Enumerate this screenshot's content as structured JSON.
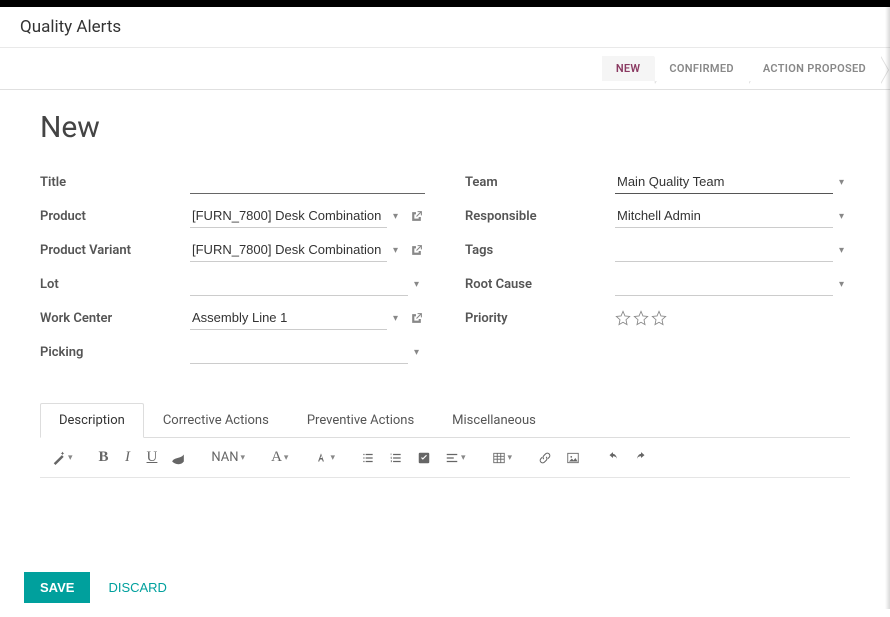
{
  "header": {
    "breadcrumb": "Quality Alerts"
  },
  "stages": {
    "new": "NEW",
    "confirmed": "CONFIRMED",
    "action_proposed": "ACTION PROPOSED"
  },
  "title_heading": "New",
  "form": {
    "title": {
      "label": "Title",
      "value": ""
    },
    "product": {
      "label": "Product",
      "value": "[FURN_7800] Desk Combination"
    },
    "product_variant": {
      "label": "Product Variant",
      "value": "[FURN_7800] Desk Combination"
    },
    "lot": {
      "label": "Lot",
      "value": ""
    },
    "work_center": {
      "label": "Work Center",
      "value": "Assembly Line 1"
    },
    "picking": {
      "label": "Picking",
      "value": ""
    },
    "team": {
      "label": "Team",
      "value": "Main Quality Team"
    },
    "responsible": {
      "label": "Responsible",
      "value": "Mitchell Admin"
    },
    "tags": {
      "label": "Tags",
      "value": ""
    },
    "root_cause": {
      "label": "Root Cause",
      "value": ""
    },
    "priority": {
      "label": "Priority"
    }
  },
  "tabs": {
    "description": "Description",
    "corrective": "Corrective Actions",
    "preventive": "Preventive Actions",
    "misc": "Miscellaneous"
  },
  "toolbar": {
    "font_size_label": "NAN"
  },
  "footer": {
    "save": "SAVE",
    "discard": "DISCARD"
  }
}
